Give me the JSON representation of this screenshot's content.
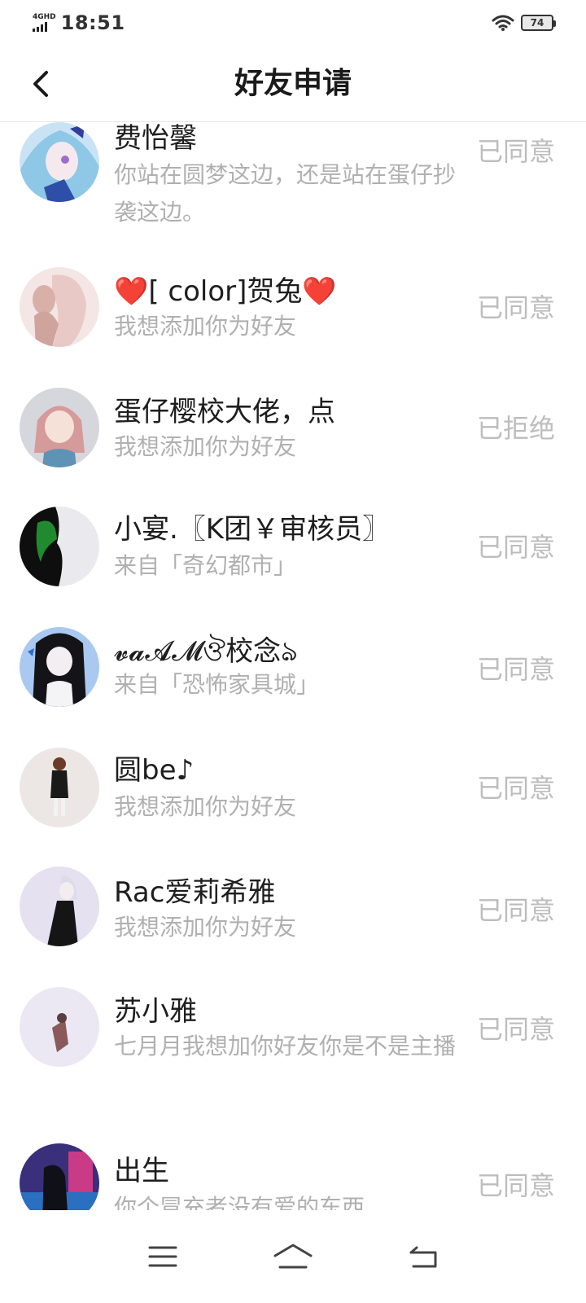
{
  "status_bar": {
    "network": "4GHD",
    "time": "18:51",
    "battery": "74"
  },
  "header": {
    "title": "好友申请"
  },
  "requests": [
    {
      "name": "费怡馨",
      "message": "你站在圆梦这边，还是站在蛋仔抄袭这边。",
      "status": "已同意",
      "avatar_color": "#bcd7ef"
    },
    {
      "name": "❤️[ color]贺兔❤️",
      "message": "我想添加你为好友",
      "status": "已同意",
      "avatar_color": "#f2e3e0"
    },
    {
      "name": "蛋仔樱校大佬，点",
      "message": "我想添加你为好友",
      "status": "已拒绝",
      "avatar_color": "#d8d8dc"
    },
    {
      "name": "小宴.〖K团￥审核员〗",
      "message": "来自「奇幻都市」",
      "status": "已同意",
      "avatar_color": "#e8e8ec"
    },
    {
      "name": "𝓿𝓪𝓐𝓜ঔ校念ঌ",
      "message": "来自「恐怖家具城」",
      "status": "已同意",
      "avatar_color": "#a9c9f0"
    },
    {
      "name": "圆be♪",
      "message": "我想添加你为好友",
      "status": "已同意",
      "avatar_color": "#ede6e4"
    },
    {
      "name": "Rac爱莉希雅",
      "message": "我想添加你为好友",
      "status": "已同意",
      "avatar_color": "#e6e2f1"
    },
    {
      "name": "苏小雅",
      "message": "七月月我想加你好友你是不是主播",
      "status": "已同意",
      "avatar_color": "#ebe8f4"
    },
    {
      "name": "出生",
      "message": "你个冒充者没有爱的东西",
      "status": "已同意",
      "avatar_color": "#3a2f7a"
    }
  ],
  "icons": {
    "back": "chevron-left-icon",
    "menu": "menu-icon",
    "home": "home-icon",
    "return": "back-arrow-icon",
    "wifi": "wifi-icon",
    "signal": "signal-icon",
    "battery": "battery-icon"
  }
}
